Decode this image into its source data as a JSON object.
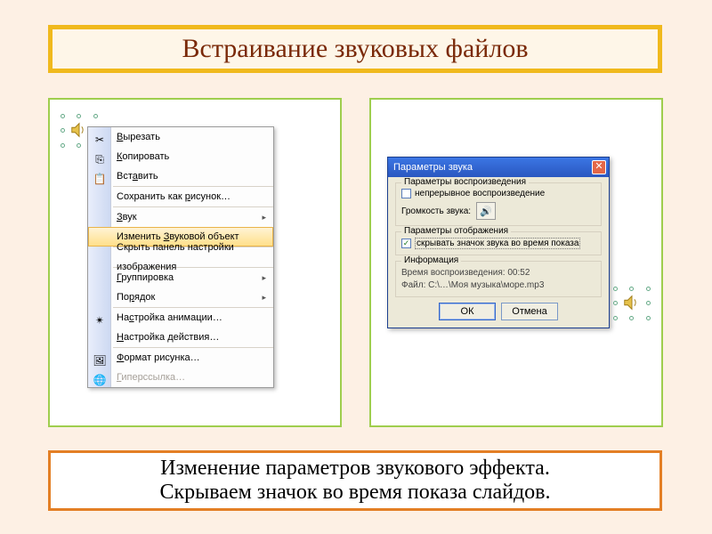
{
  "title": "Встраивание звуковых файлов",
  "caption": {
    "line1": "Изменение параметров звукового эффекта.",
    "line2": "Скрываем значок во время показа слайдов."
  },
  "context_menu": {
    "cut": {
      "label_pre": "",
      "label_u": "В",
      "label_post": "ырезать"
    },
    "copy": {
      "label_pre": "",
      "label_u": "К",
      "label_post": "опировать"
    },
    "paste": {
      "label_pre": "Вст",
      "label_u": "а",
      "label_post": "вить"
    },
    "save_pic": {
      "label_pre": "Сохранить как ",
      "label_u": "р",
      "label_post": "исунок…"
    },
    "sound": {
      "label_pre": "",
      "label_u": "З",
      "label_post": "вук"
    },
    "edit_obj": {
      "label_pre": "Изменить ",
      "label_u": "З",
      "label_post": "вуковой объект"
    },
    "hide_tb": {
      "label": "Скрыть панель настройки изображения"
    },
    "group": {
      "label_pre": "",
      "label_u": "Г",
      "label_post": "руппировка"
    },
    "order": {
      "label_pre": "По",
      "label_u": "р",
      "label_post": "ядок"
    },
    "anim": {
      "label_pre": "На",
      "label_u": "с",
      "label_post": "тройка анимации…"
    },
    "action": {
      "label_pre": "",
      "label_u": "Н",
      "label_post": "астройка действия…"
    },
    "format": {
      "label_pre": "",
      "label_u": "Ф",
      "label_post": "ормат рисунка…"
    },
    "hyperlink": {
      "label_pre": "",
      "label_u": "Г",
      "label_post": "иперссылка…"
    }
  },
  "dialog": {
    "title": "Параметры звука",
    "group_play": "Параметры воспроизведения",
    "chk_loop": "непрерывное воспроизведение",
    "volume_label": "Громкость звука:",
    "group_display": "Параметры отображения",
    "chk_hide": "скрывать значок звука во время показа",
    "group_info": "Информация",
    "info_time": "Время воспроизведения: 00:52",
    "info_file": "Файл: C:\\…\\Моя музыка\\море.mp3",
    "ok": "ОК",
    "cancel": "Отмена"
  }
}
